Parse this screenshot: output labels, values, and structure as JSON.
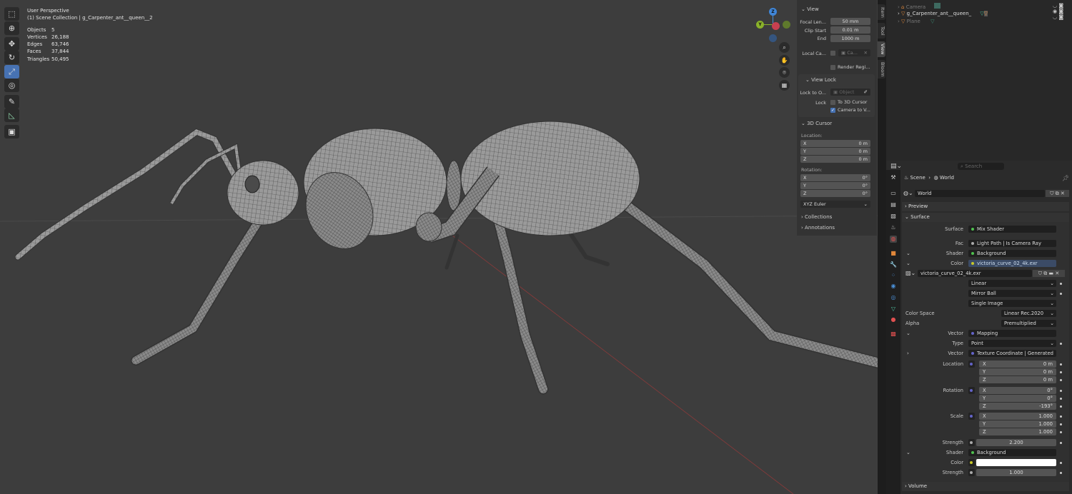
{
  "viewport": {
    "title": "User Perspective",
    "collection": "(1) Scene Collection | g_Carpenter_ant__queen__2",
    "stats": [
      {
        "label": "Objects",
        "value": "5"
      },
      {
        "label": "Vertices",
        "value": "26,188"
      },
      {
        "label": "Edges",
        "value": "63,746"
      },
      {
        "label": "Faces",
        "value": "37,844"
      },
      {
        "label": "Triangles",
        "value": "50,495"
      }
    ],
    "tools": [
      "select-box",
      "cursor",
      "move",
      "rotate",
      "scale",
      "transform",
      "annotate",
      "measure",
      "add-cube"
    ],
    "active_tool": "scale",
    "gizmo": {
      "z": "Z",
      "y": "Y"
    }
  },
  "npanel": {
    "tabs": [
      "Item",
      "Tool",
      "View",
      "Bloom"
    ],
    "active_tab": "View",
    "view_header": "View",
    "focal_label": "Focal Len...",
    "focal_value": "50 mm",
    "clip_start_label": "Clip Start",
    "clip_start_value": "0.01 m",
    "end_label": "End",
    "end_value": "1000 m",
    "local_camera_label": "Local Ca...",
    "local_camera_value": "Ca...",
    "render_region_label": "Render Regi...",
    "view_lock_header": "View Lock",
    "lock_to_object_label": "Lock to O...",
    "lock_to_object_placeholder": "Object",
    "lock_label": "Lock",
    "to_3d_cursor": "To 3D Cursor",
    "camera_to_view": "Camera to V...",
    "cursor_header": "3D Cursor",
    "location_label": "Location:",
    "location": [
      {
        "axis": "X",
        "value": "0 m"
      },
      {
        "axis": "Y",
        "value": "0 m"
      },
      {
        "axis": "Z",
        "value": "0 m"
      }
    ],
    "rotation_label": "Rotation:",
    "rotation": [
      {
        "axis": "X",
        "value": "0°"
      },
      {
        "axis": "Y",
        "value": "0°"
      },
      {
        "axis": "Z",
        "value": "0°"
      }
    ],
    "rotation_mode": "XYZ Euler",
    "collections": "Collections",
    "annotations": "Annotations"
  },
  "outliner": {
    "items": [
      {
        "name": "Camera"
      },
      {
        "name": "g_Carpenter_ant__queen_"
      },
      {
        "name": "Plane"
      }
    ]
  },
  "properties": {
    "search_placeholder": "Search",
    "breadcrumb": [
      "Scene",
      "World"
    ],
    "world_name": "World",
    "preview": "Preview",
    "surface_section": "Surface",
    "volume": "Volume",
    "rows": {
      "surface": {
        "label": "Surface",
        "value": "Mix Shader"
      },
      "fac": {
        "label": "Fac",
        "value": "Light Path | Is Camera Ray"
      },
      "shader1": {
        "label": "Shader",
        "value": "Background"
      },
      "color1": {
        "label": "Color",
        "value": "victoria_curve_02_4k.exr"
      },
      "image": "victoria_curve_02_4k.exr",
      "interp": "Linear",
      "projection": "Mirror Ball",
      "source": "Single Image",
      "color_space": {
        "label": "Color Space",
        "value": "Linear Rec.2020"
      },
      "alpha": {
        "label": "Alpha",
        "value": "Premultiplied"
      },
      "vector1": {
        "label": "Vector",
        "value": "Mapping"
      },
      "type": {
        "label": "Type",
        "value": "Point"
      },
      "vector2": {
        "label": "Vector",
        "value": "Texture Coordinate | Generated"
      },
      "location": {
        "label": "Location",
        "values": [
          {
            "axis": "X",
            "value": "0 m"
          },
          {
            "axis": "Y",
            "value": "0 m"
          },
          {
            "axis": "Z",
            "value": "0 m"
          }
        ]
      },
      "rotation": {
        "label": "Rotation",
        "values": [
          {
            "axis": "X",
            "value": "0°"
          },
          {
            "axis": "Y",
            "value": "0°"
          },
          {
            "axis": "Z",
            "value": "-193°"
          }
        ]
      },
      "scale": {
        "label": "Scale",
        "values": [
          {
            "axis": "X",
            "value": "1.000"
          },
          {
            "axis": "Y",
            "value": "1.000"
          },
          {
            "axis": "Z",
            "value": "1.000"
          }
        ]
      },
      "strength1": {
        "label": "Strength",
        "value": "2.200"
      },
      "shader2": {
        "label": "Shader",
        "value": "Background"
      },
      "color2": {
        "label": "Color",
        "value": "#ffffff"
      },
      "strength2": {
        "label": "Strength",
        "value": "1.000"
      }
    }
  },
  "colors": {
    "accent": "#4772b3",
    "viewport_bg": "#3d3d3d",
    "shader_socket": "#4fc14f",
    "color_socket": "#c7c729",
    "vector_socket": "#6363c7"
  }
}
